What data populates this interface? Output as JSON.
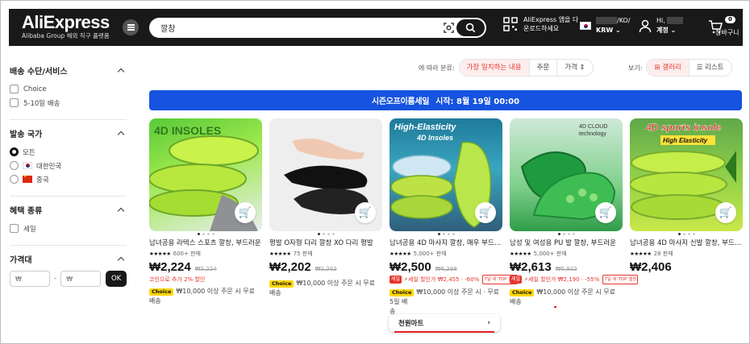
{
  "header": {
    "logo": "AliExpress",
    "logo_sub": "Alibaba Group 해외 직구 플랫폼",
    "search_value": "깔창",
    "app_promo": "AliExpress 앱을 다운로드하세요",
    "region": "/KO/",
    "currency": "KRW",
    "greeting": "Hi,",
    "account": "계정",
    "cart_count": "0",
    "cart_label": "장바구니"
  },
  "sidebar": {
    "shipping": {
      "title": "배송 수단/서비스",
      "options": [
        "Choice",
        "5-10일 배송"
      ]
    },
    "origin": {
      "title": "발송 국가",
      "options": [
        "모든",
        "대한민국",
        "중국"
      ]
    },
    "benefit": {
      "title": "혜택 종류",
      "options": [
        "세일"
      ]
    },
    "price": {
      "title": "가격대",
      "min_placeholder": "₩",
      "max_placeholder": "₩",
      "ok": "OK"
    }
  },
  "sort": {
    "label": "에 따라 분류:",
    "options": [
      "가장 일치하는 내용",
      "주문",
      "가격"
    ],
    "view_label": "보기:",
    "gallery": "갤러리",
    "list": "리스트"
  },
  "banner": {
    "shop": "시즌오프이름세일",
    "text": "시작: 8월 19일 00:00"
  },
  "products": [
    {
      "image_text": "4D INSOLES",
      "title": "남녀공용 라텍스 스포츠 깔창, 부드러운",
      "sold": "600+ 판매",
      "price": "₩2,224",
      "old": "₩2,224",
      "coin": "코인으로 추가 2% 할인",
      "choice": "Choice",
      "ship1": "₩10,000 이상 주문 시 무료",
      "ship2": "배송"
    },
    {
      "image_text": "",
      "title": "평발 O자형 다리 깔창 XO 다리 평발",
      "sold": "75 판매",
      "price": "₩2,202",
      "old": "₩2,202",
      "choice": "Choice",
      "ship1": "₩10,000 이상 주문 시 무료",
      "ship2": "배송"
    },
    {
      "image_text": "High-Elasticity",
      "image_sub": "4D Insoles",
      "title": "남녀공용 4D 마사지 깔창, 매우 부드러운",
      "sold": "5,000+ 판매",
      "price": "₩2,500",
      "old": "₩6,298",
      "sale": "세일",
      "deal": "세일 할인가 ₩2,455 · -60%",
      "top": "7일 내 TOP 셀링",
      "choice": "Choice",
      "ship1": "₩10,000 이상 주문 시 · 무료 5일 배",
      "ship2": "송"
    },
    {
      "image_text": "4D CLOUD",
      "image_sub": "technology",
      "title": "남성 및 여성용 PU 발 깔창, 부드러운",
      "sold": "5,000+ 판매",
      "price": "₩2,613",
      "old": "₩5,922",
      "sale": "세일",
      "deal": "세일 할인가 ₩2,190 · -55%",
      "top": "7일 내 TOP 셀링",
      "choice": "Choice",
      "ship1": "₩10,000 이상 주문 시 무료",
      "ship2": "배송"
    },
    {
      "image_text": "4D sports insole",
      "image_sub": "High Elasticity",
      "title": "남녀공용 4D 마사지 신발 깔창, 부드러운",
      "sold": "28 판매",
      "price": "₩2,406"
    }
  ],
  "store_popup": {
    "label": "천원마트"
  },
  "colors": {
    "accent": "#e6352d",
    "banner": "#1553e0",
    "topbar": "#191919",
    "choice": "#ffd600"
  }
}
